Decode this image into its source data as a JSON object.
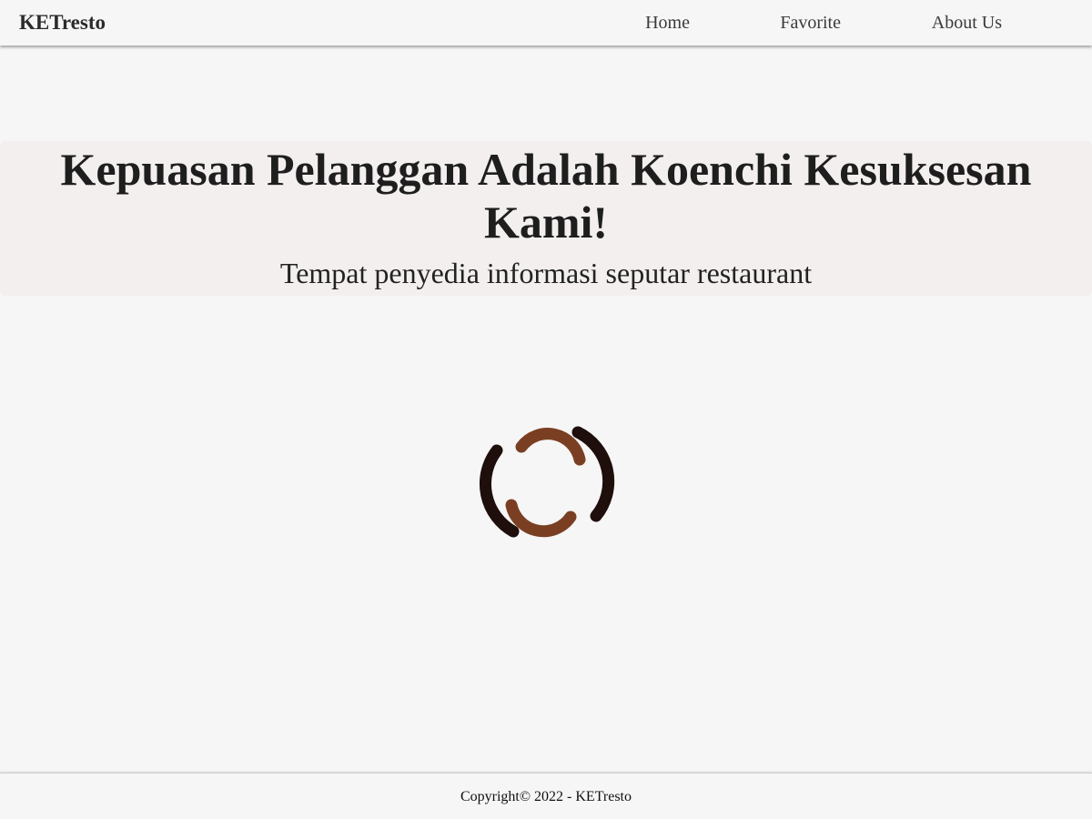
{
  "header": {
    "brand": "KETresto",
    "nav": [
      {
        "label": "Home"
      },
      {
        "label": "Favorite"
      },
      {
        "label": "About Us"
      }
    ]
  },
  "hero": {
    "title": "Kepuasan Pelanggan Adalah Koenchi Kesuksesan Kami!",
    "subtitle": "Tempat penyedia informasi seputar restaurant"
  },
  "loader": {
    "icon": "loading-spinner-icon",
    "colors": {
      "outer": "#1e0f0c",
      "inner": "#7a3f22"
    }
  },
  "footer": {
    "copyright": "Copyright© 2022 - KETresto"
  }
}
